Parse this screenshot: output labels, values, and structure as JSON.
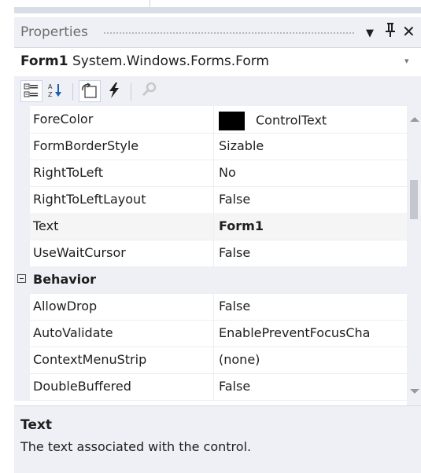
{
  "panel": {
    "title": "Properties",
    "buttons": {
      "dropdown": "▼",
      "pin": "ᛰ",
      "close": "✕"
    }
  },
  "object_selector": {
    "name": "Form1",
    "type": "System.Windows.Forms.Form",
    "arrow": "▾"
  },
  "toolbar": {
    "icons": [
      "categorized-icon",
      "alphabetical-icon",
      "properties-icon",
      "events-icon",
      "property-pages-icon"
    ]
  },
  "rows": [
    {
      "name": "ForeColor",
      "value": "ControlText",
      "swatch": "#000000"
    },
    {
      "name": "FormBorderStyle",
      "value": "Sizable"
    },
    {
      "name": "RightToLeft",
      "value": "No"
    },
    {
      "name": "RightToLeftLayout",
      "value": "False"
    },
    {
      "name": "Text",
      "value": "Form1",
      "bold": true
    },
    {
      "name": "UseWaitCursor",
      "value": "False"
    },
    {
      "category": "Behavior"
    },
    {
      "name": "AllowDrop",
      "value": "False"
    },
    {
      "name": "AutoValidate",
      "value": "EnablePreventFocusCha"
    },
    {
      "name": "ContextMenuStrip",
      "value": "(none)"
    },
    {
      "name": "DoubleBuffered",
      "value": "False"
    }
  ],
  "description": {
    "title": "Text",
    "text": "The text associated with the control."
  }
}
